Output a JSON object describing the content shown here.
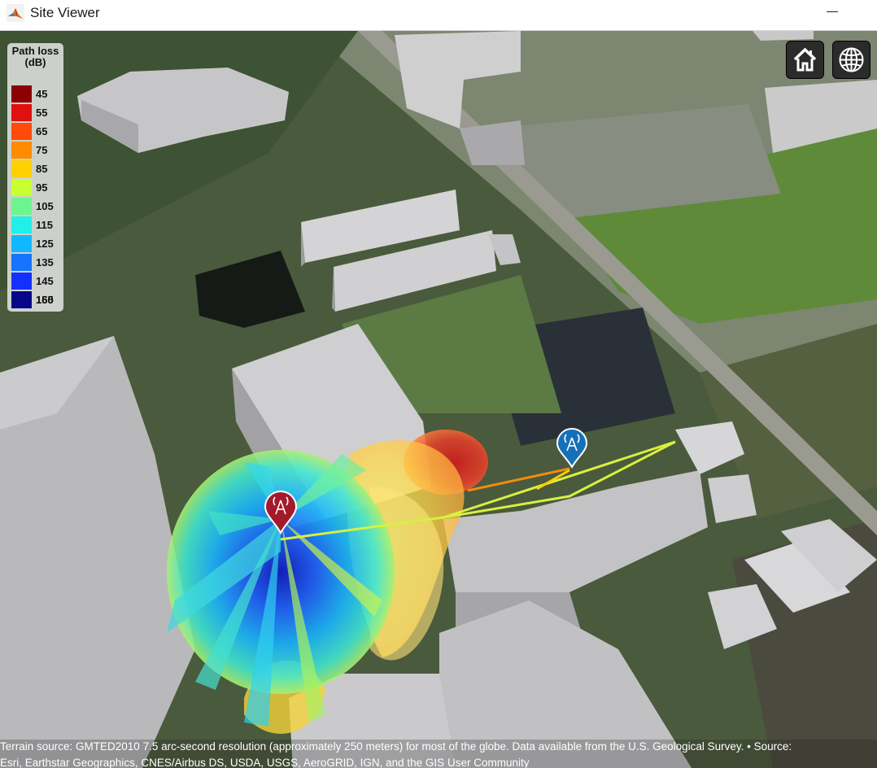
{
  "window": {
    "title": "Site Viewer",
    "app_icon": "matlab-icon",
    "minimize_icon": "minimize-icon"
  },
  "legend": {
    "title": "Path loss (dB)",
    "items": [
      {
        "label": "45",
        "color": "#8b0000"
      },
      {
        "label": "55",
        "color": "#e01010"
      },
      {
        "label": "65",
        "color": "#ff4a0a"
      },
      {
        "label": "75",
        "color": "#ff8c00"
      },
      {
        "label": "85",
        "color": "#ffd000"
      },
      {
        "label": "95",
        "color": "#c8ff30"
      },
      {
        "label": "105",
        "color": "#6cf58c"
      },
      {
        "label": "115",
        "color": "#20f0e8"
      },
      {
        "label": "125",
        "color": "#12b8ff"
      },
      {
        "label": "135",
        "color": "#1674ff"
      },
      {
        "label": "145",
        "color": "#1430ff"
      },
      {
        "label": "155",
        "color": "#0c14c8"
      },
      {
        "label": "160",
        "color": "#06068a"
      }
    ]
  },
  "controls": {
    "home_icon": "home-icon",
    "globe_icon": "globe-icon"
  },
  "markers": {
    "transmitter_icon": "antenna-tower-icon",
    "transmitter_color": "#a31a2b",
    "receiver_icon": "antenna-tower-icon",
    "receiver_color": "#1670b8"
  },
  "attribution": {
    "line1": "Terrain source: GMTED2010 7.5 arc-second resolution (approximately 250 meters) for most of the globe. Data available from the U.S. Geological Survey. • Source:",
    "line2": "Esri, Earthstar Geographics, CNES/Airbus DS, USDA, USGS, AeroGRID, IGN, and the GIS User Community"
  }
}
